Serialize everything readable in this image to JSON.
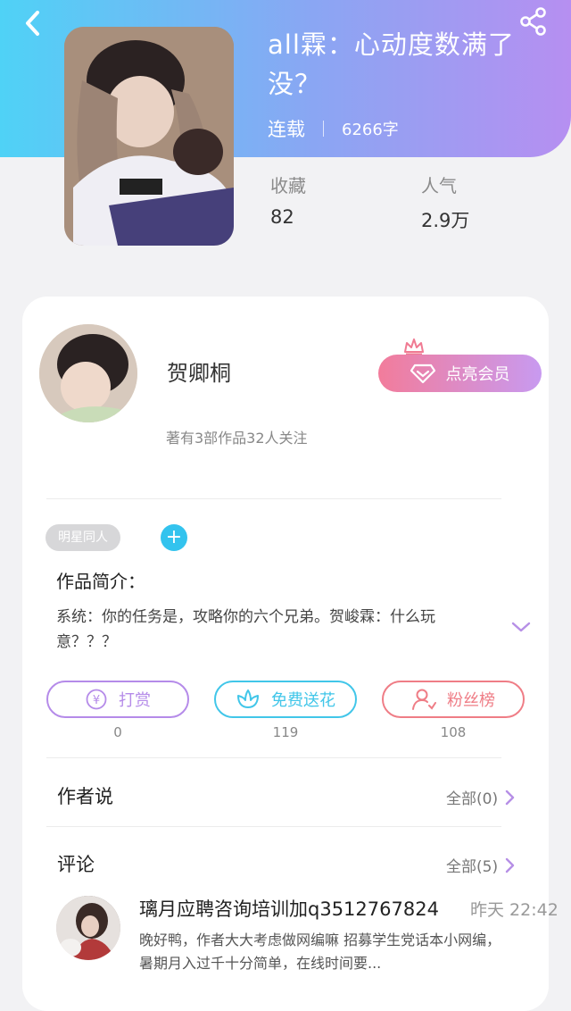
{
  "book": {
    "title": "all霖：心动度数满了没？",
    "status": "连载",
    "word_count": "6266字",
    "favorites_label": "收藏",
    "favorites_value": "82",
    "popularity_label": "人气",
    "popularity_value": "2.9万"
  },
  "author": {
    "name": "贺卿桐",
    "meta": "著有3部作品32人关注",
    "vip_button": "点亮会员"
  },
  "tags": [
    "明星同人"
  ],
  "intro": {
    "title": "作品简介：",
    "text": "系统：你的任务是，攻略你的六个兄弟。贺峻霖：什么玩意？？？"
  },
  "actions": [
    {
      "label": "打赏",
      "count": "0",
      "color": "#b58be9",
      "icon": "yuan-icon"
    },
    {
      "label": "免费送花",
      "count": "119",
      "color": "#41c6e9",
      "icon": "flower-icon"
    },
    {
      "label": "粉丝榜",
      "count": "108",
      "color": "#ef7d86",
      "icon": "fans-icon"
    }
  ],
  "author_says": {
    "title": "作者说",
    "more": "全部(0)"
  },
  "comments": {
    "title": "评论",
    "more": "全部(5)",
    "first": {
      "name": "璃月应聘咨询培训加q3512767824",
      "time": "昨天 22:42",
      "text": "晚好鸭，作者大大考虑做网编嘛 招募学生党话本小网编，暑期月入过千十分简单，在线时间要..."
    }
  }
}
